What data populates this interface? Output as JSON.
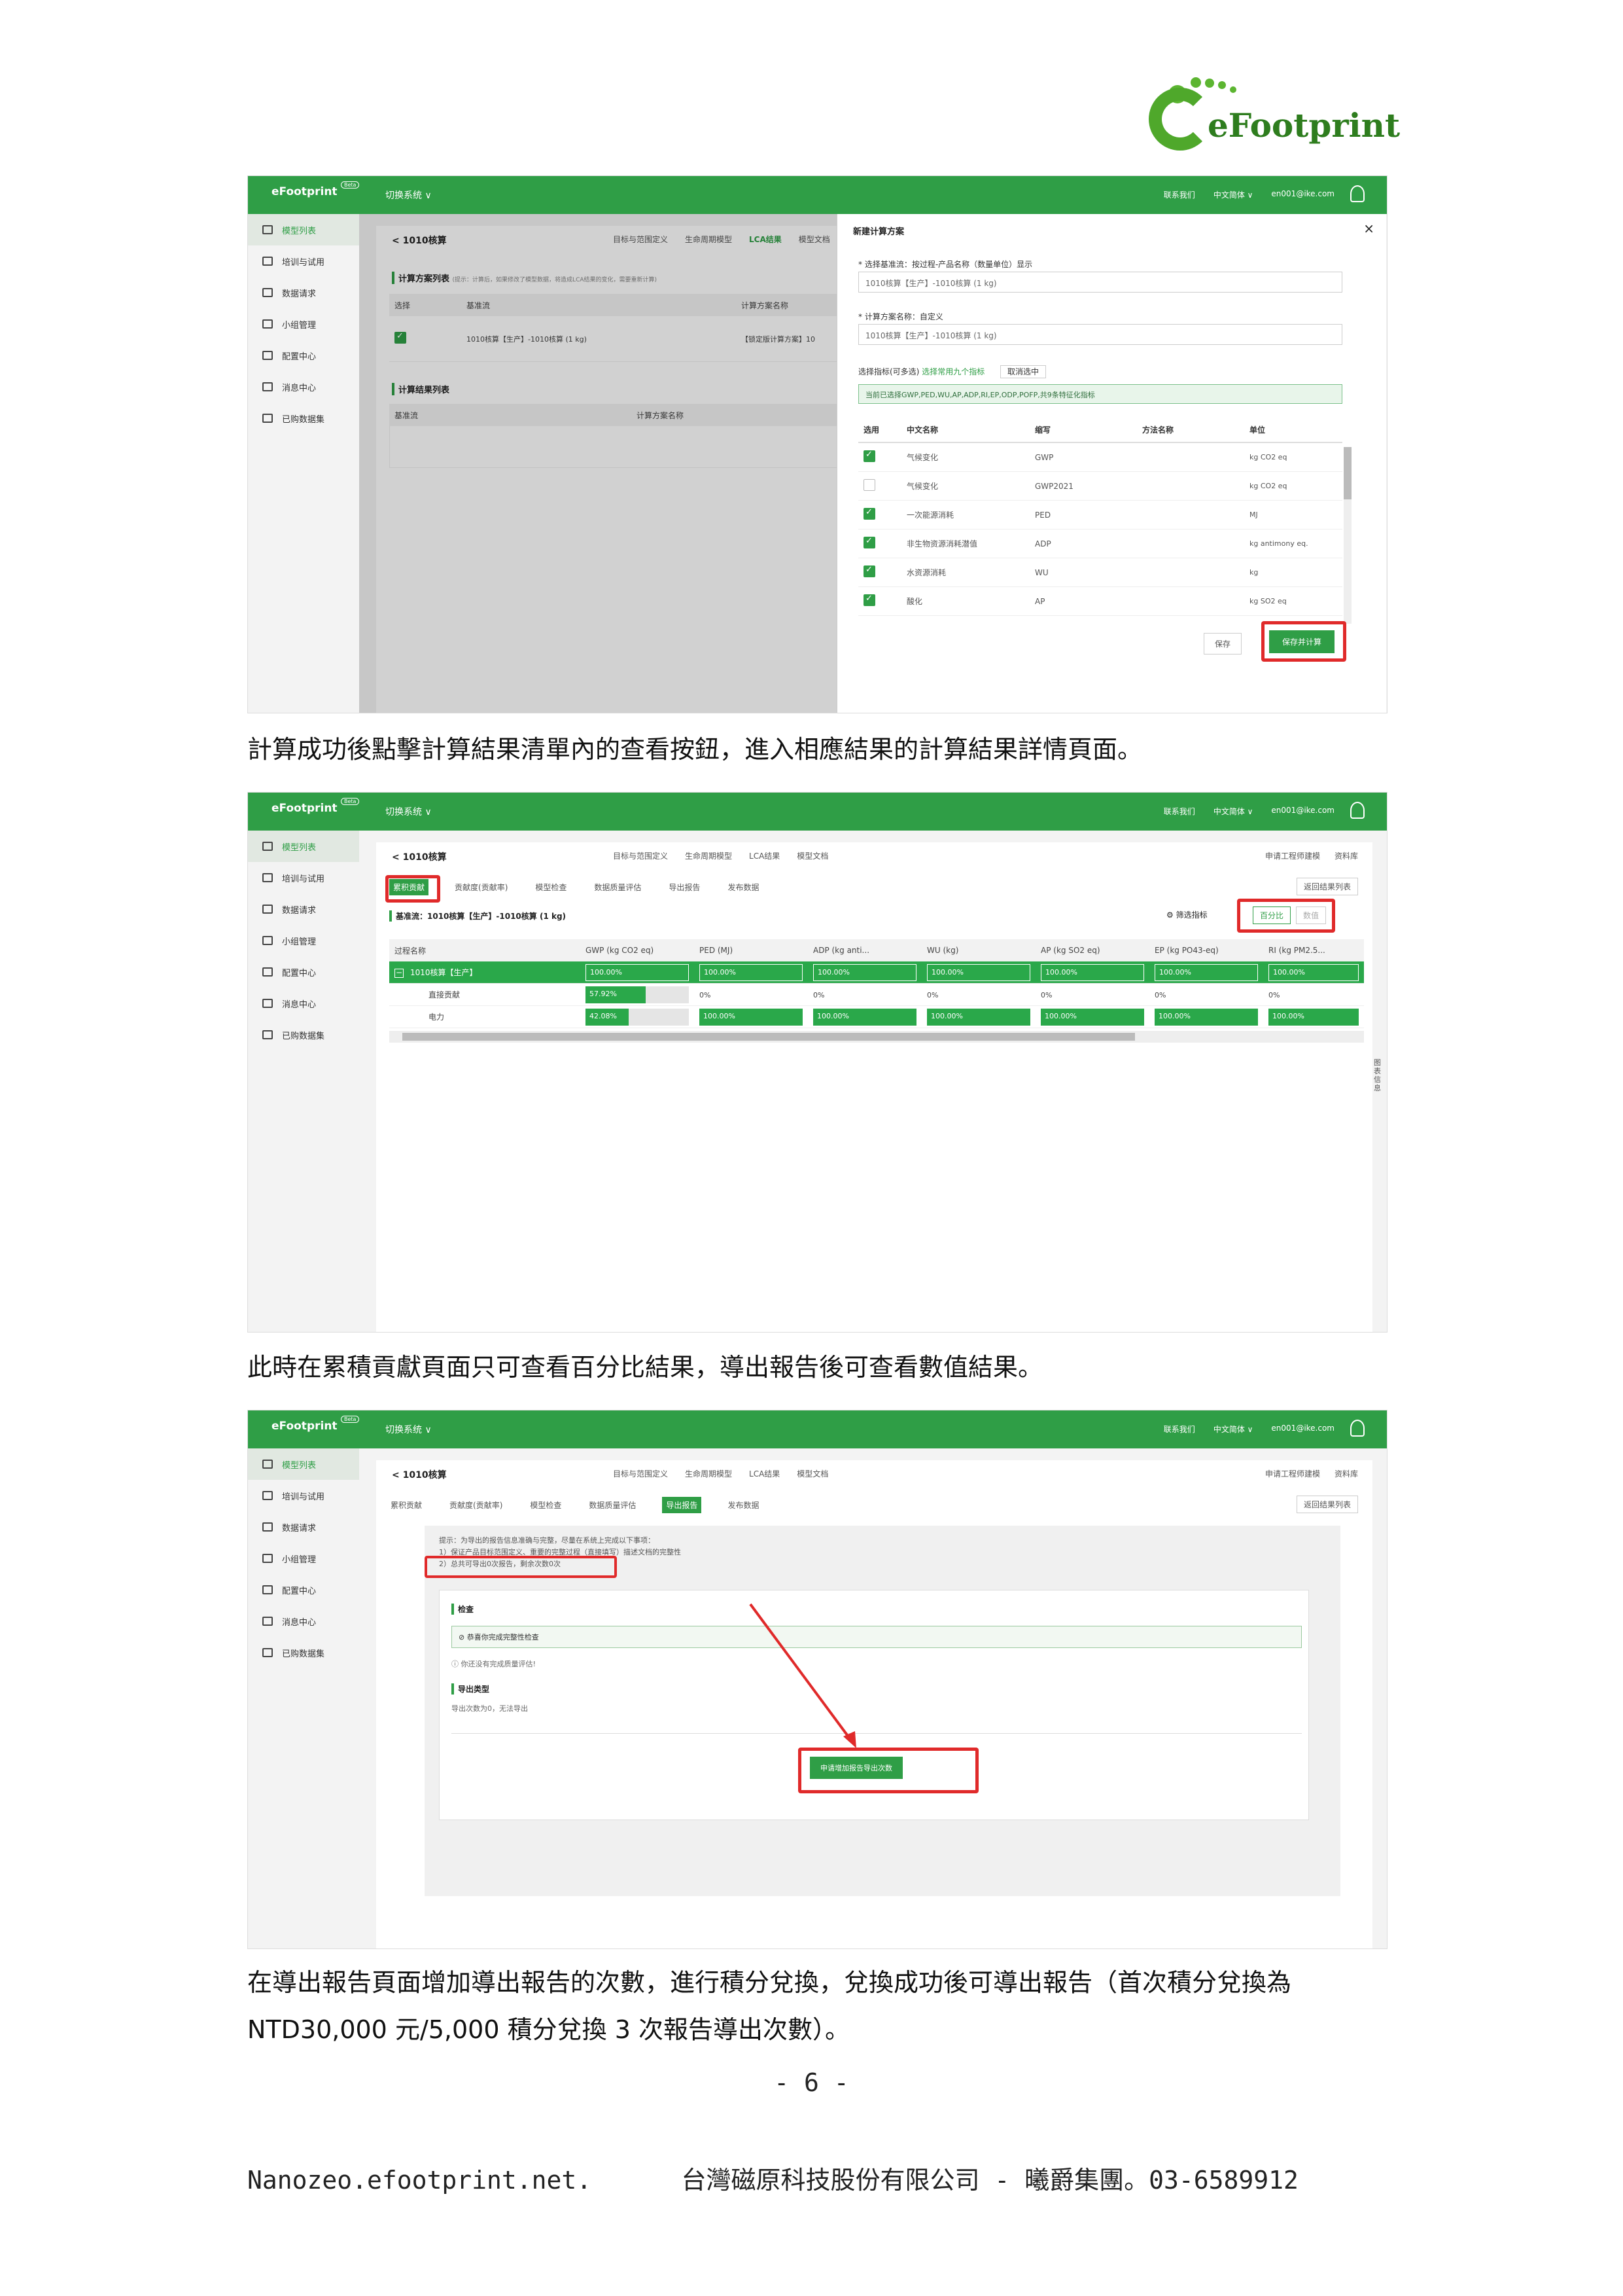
{
  "logo": {
    "text": "eFootprint"
  },
  "app": {
    "brand": "eFootprint",
    "beta": "Beta",
    "switch_system": "切换系统 ∨",
    "top_links": [
      "联系我们",
      "中文简体 ∨",
      "en001@ike.com"
    ],
    "sidebar": [
      "模型列表",
      "培训与试用",
      "数据请求",
      "小组管理",
      "配置中心",
      "消息中心",
      "已购数据集"
    ],
    "crumb": "< 1010核算",
    "tabs": [
      "目标与范围定义",
      "生命周期模型",
      "LCA结果",
      "模型文档"
    ],
    "right_links": [
      "申请工程师建模",
      "资料库"
    ]
  },
  "shot1": {
    "calc_list_title": "计算方案列表",
    "calc_list_hint": "(提示：计算后，如果修改了模型数据，将造成LCA结果的变化，需要重新计算)",
    "headers": [
      "选择",
      "基准流",
      "计算方案名称"
    ],
    "row": [
      "1010核算【生产】-1010核算 (1 kg)",
      "【锁定版计算方案】10"
    ],
    "result_list_title": "计算结果列表",
    "result_headers": [
      "基准流",
      "计算方案名称"
    ],
    "dialog": {
      "title": "新建计算方案",
      "close": "×",
      "base_label": "* 选择基准流：按过程-产品名称（数量单位）显示",
      "base_value": "1010核算【生产】-1010核算 (1 kg)",
      "name_label": "* 计算方案名称：自定义",
      "name_value": "1010核算【生产】-1010核算 (1 kg)",
      "indicator_label": "选择指标(可多选)",
      "indicator_link": "选择常用九个指标",
      "cancel_select": "取消选中",
      "selected_hint": "当前已选择GWP,PED,WU,AP,ADP,RI,EP,ODP,POFP,共9条特征化指标",
      "headers": [
        "选用",
        "中文名称",
        "缩写",
        "方法名称",
        "单位"
      ],
      "rows": [
        {
          "name": "气候变化",
          "abbr": "GWP",
          "unit": "kg CO2 eq",
          "on": true
        },
        {
          "name": "气候变化",
          "abbr": "GWP2021",
          "unit": "kg CO2 eq",
          "on": false
        },
        {
          "name": "一次能源消耗",
          "abbr": "PED",
          "unit": "MJ",
          "on": true
        },
        {
          "name": "非生物资源消耗潜值",
          "abbr": "ADP",
          "unit": "kg antimony eq.",
          "on": true
        },
        {
          "name": "水资源消耗",
          "abbr": "WU",
          "unit": "kg",
          "on": true
        },
        {
          "name": "酸化",
          "abbr": "AP",
          "unit": "kg SO2 eq",
          "on": true
        }
      ],
      "save": "保存",
      "save_calc": "保存并计算"
    }
  },
  "para1": "計算成功後點擊計算結果清單內的查看按鈕，進入相應結果的計算結果詳情頁面。",
  "shot2": {
    "subtabs": [
      "累积贡献",
      "贡献度(贡献率)",
      "模型检查",
      "数据质量评估",
      "导出报告",
      "发布数据"
    ],
    "back": "返回结果列表",
    "base": "基准流：1010核算【生产】-1010核算 (1 kg)",
    "filter": "筛选指标",
    "percent": "百分比",
    "value": "数值",
    "headers": [
      "过程名称",
      "GWP (kg CO2 eq)",
      "PED (MJ)",
      "ADP (kg anti...",
      "WU (kg)",
      "AP (kg SO2 eq)",
      "EP (kg PO43-eq)",
      "RI (kg PM2.5..."
    ],
    "rows": [
      {
        "name": "1010核算【生产】",
        "labels": [
          "100.00%",
          "100.00%",
          "100.00%",
          "100.00%",
          "100.00%",
          "100.00%",
          "100.00%"
        ],
        "fills": [
          100,
          100,
          100,
          100,
          100,
          100,
          100
        ]
      },
      {
        "name": "直接贡献",
        "labels": [
          "57.92%",
          "0%",
          "0%",
          "0%",
          "0%",
          "0%",
          "0%"
        ],
        "fills": [
          57.92,
          0,
          0,
          0,
          0,
          0,
          0
        ]
      },
      {
        "name": "电力",
        "labels": [
          "42.08%",
          "100.00%",
          "100.00%",
          "100.00%",
          "100.00%",
          "100.00%",
          "100.00%"
        ],
        "fills": [
          42.08,
          100,
          100,
          100,
          100,
          100,
          100
        ]
      }
    ],
    "side_label": "图表信息"
  },
  "para2": "此時在累積貢獻頁面只可查看百分比結果，導出報告後可查看數值結果。",
  "shot3": {
    "notice_lines": [
      "提示：为导出的报告信息准确与完整，尽量在系统上完成以下事项：",
      "1）保证产品目标范围定义、重要的完整过程（直接填写）描述文档的完整性",
      "2）总共可导出0次报告，剩余次数0次"
    ],
    "check_title": "检查",
    "check_ok": "恭喜你完成完整性检查",
    "check_warn": "你还没有完成质量评估!",
    "export_title": "导出类型",
    "export_text": "导出次数为0，无法导出",
    "apply_btn": "申请增加报告导出次数"
  },
  "para3_line1": "在導出報告頁面增加導出報告的次數，進行積分兌換，兌換成功後可導出報告（首次積分兌換為",
  "para3_line2": "NTD30,000 元/5,000 積分兌換 3 次報告導出次數）。",
  "page_number": "- 6 -",
  "footer": "Nanozeo.efootprint.net.      台灣磁原科技股份有限公司 - 曦爵集團。03-6589912",
  "colors": {
    "brand_green": "#2f9e46",
    "highlight_red": "#e02a2a"
  }
}
